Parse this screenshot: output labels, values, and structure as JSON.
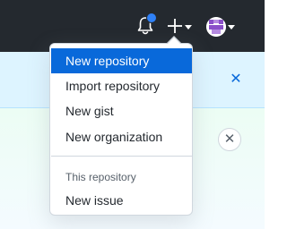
{
  "header": {
    "notification_icon": "bell-icon",
    "create_icon": "plus-icon",
    "avatar_icon": "user-avatar",
    "bg_color": "#24292f",
    "indicator_color": "#2f81f7"
  },
  "create_menu": {
    "items": [
      {
        "label": "New repository",
        "active": true
      },
      {
        "label": "Import repository"
      },
      {
        "label": "New gist"
      },
      {
        "label": "New organization"
      }
    ],
    "section_header": "This repository",
    "section_items": [
      {
        "label": "New issue"
      }
    ],
    "active_color": "#0969da"
  },
  "banner": {
    "close_icon": "close-icon",
    "bg_color": "#ddf4ff"
  },
  "panel": {
    "close_icon": "close-icon"
  }
}
